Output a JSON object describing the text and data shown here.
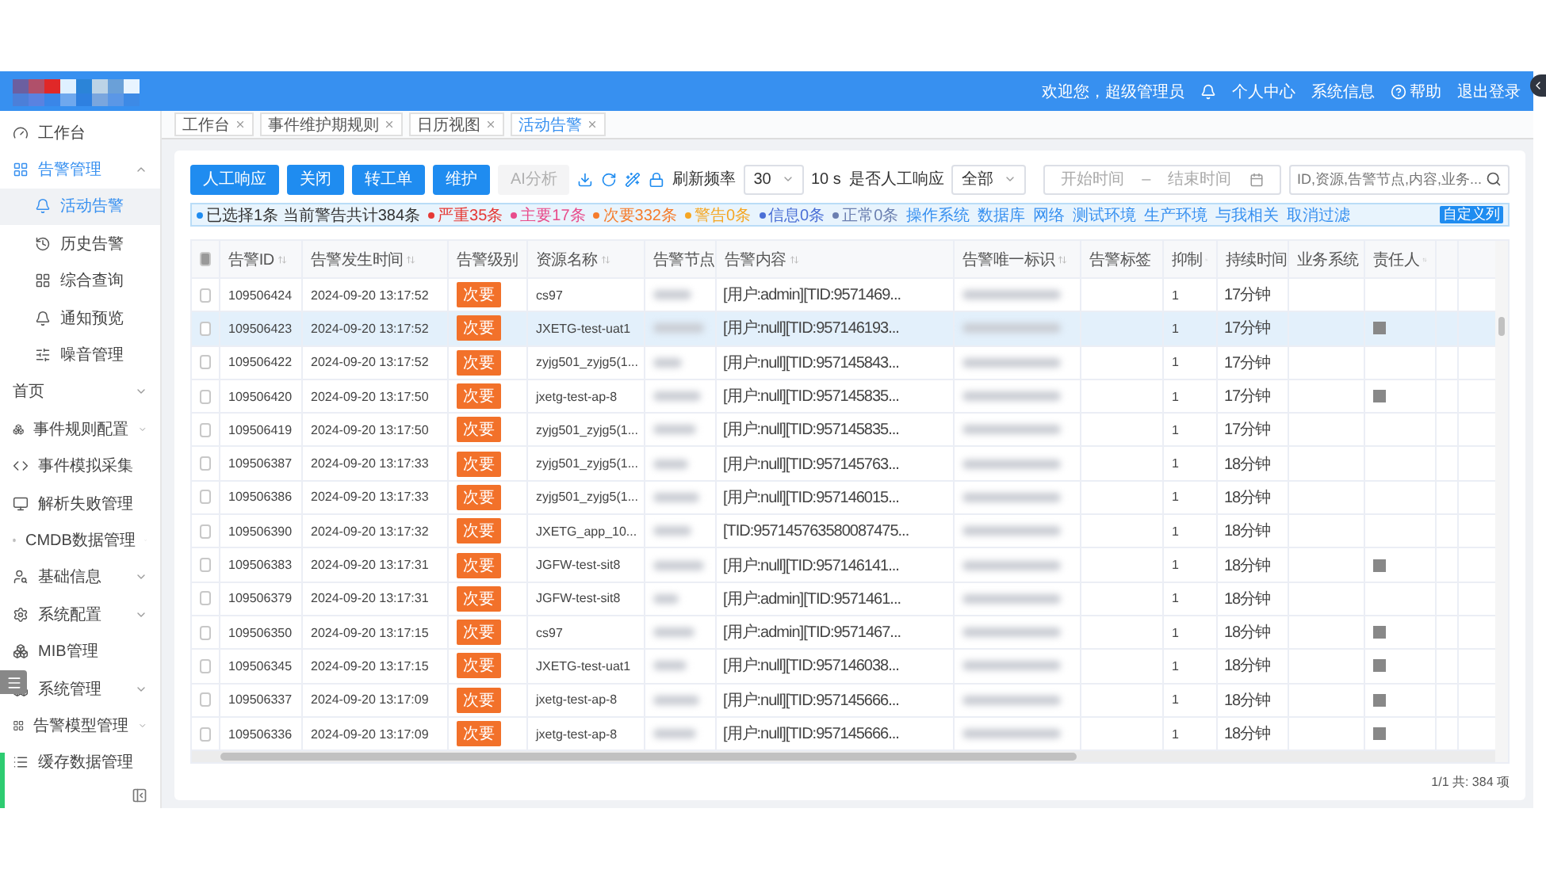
{
  "header": {
    "greeting": "欢迎您，超级管理员",
    "links": [
      {
        "kind": "bell"
      },
      {
        "kind": "text",
        "label": "个人中心"
      },
      {
        "kind": "text",
        "label": "系统信息"
      },
      {
        "kind": "help",
        "label": "帮助"
      },
      {
        "kind": "text",
        "label": "退出登录"
      }
    ]
  },
  "sidebar": {
    "items": [
      {
        "label": "工作台"
      },
      {
        "label": "告警管理",
        "expanded": true,
        "children": [
          {
            "label": "活动告警",
            "selected": true
          },
          {
            "label": "历史告警",
            "selected": false
          },
          {
            "label": "综合查询",
            "selected": false
          },
          {
            "label": "通知预览",
            "selected": false
          },
          {
            "label": "噪音管理",
            "selected": false
          }
        ]
      },
      {
        "label": "首页",
        "expanded": false
      },
      {
        "label": "事件规则配置",
        "expanded": false
      },
      {
        "label": "事件模拟采集"
      },
      {
        "label": "解析失败管理"
      },
      {
        "label": "CMDB数据管理",
        "expanded": false
      },
      {
        "label": "基础信息",
        "expanded": false
      },
      {
        "label": "系统配置",
        "expanded": false
      },
      {
        "label": "MIB管理"
      },
      {
        "label": "系统管理",
        "expanded": false
      },
      {
        "label": "告警模型管理",
        "expanded": false
      },
      {
        "label": "缓存数据管理"
      }
    ]
  },
  "tabs": [
    {
      "label": "工作台",
      "selected": false
    },
    {
      "label": "事件维护期规则",
      "selected": false
    },
    {
      "label": "日历视图",
      "selected": false
    },
    {
      "label": "活动告警",
      "selected": true
    }
  ],
  "toolbar": {
    "buttons": [
      {
        "label": "人工响应",
        "disabled": false
      },
      {
        "label": "关闭",
        "disabled": false
      },
      {
        "label": "转工单",
        "disabled": false
      },
      {
        "label": "维护",
        "disabled": false
      },
      {
        "label": "AI分析",
        "disabled": true
      }
    ],
    "refresh_label": "刷新频率",
    "refresh_value": "30",
    "refresh_reading": "10 s",
    "manual_label": "是否人工响应",
    "manual_value": "全部",
    "start_placeholder": "开始时间",
    "range_separator": "–",
    "end_placeholder": "结束时间",
    "search_placeholder": "ID,资源,告警节点,内容,业务..."
  },
  "filter_bar": {
    "summary": "已选择1条 当前警告共计384条",
    "severities": [
      {
        "label": "严重35条",
        "color": "#e53935"
      },
      {
        "label": "主要17条",
        "color": "#e84c8b"
      },
      {
        "label": "次要332条",
        "color": "#f57c2c"
      },
      {
        "label": "警告0条",
        "color": "#f5a623"
      },
      {
        "label": "信息0条",
        "color": "#4a6fd6"
      },
      {
        "label": "正常0条",
        "color": "#6b7fb0"
      }
    ],
    "tags": [
      "操作系统",
      "数据库",
      "网络",
      "测试环境",
      "生产环境",
      "与我相关"
    ],
    "clear": "取消过滤",
    "custom_columns": "自定义列"
  },
  "table": {
    "select_all_partial": true,
    "columns": [
      "告警ID",
      "告警发生时间",
      "告警级别",
      "资源名称",
      "告警节点",
      "告警内容",
      "告警唯一标识",
      "告警标签",
      "抑制",
      "持续时间",
      "业务系统",
      "责任人"
    ],
    "rows": [
      {
        "id": "109506424",
        "time": "2024-09-20 13:17:52",
        "level": "次要",
        "resource": "cs97",
        "content": "[用户:admin][TID:9571469...",
        "suppress": "1",
        "duration": "17分钟",
        "owner_shown": false,
        "selected": false
      },
      {
        "id": "109506423",
        "time": "2024-09-20 13:17:52",
        "level": "次要",
        "resource": "JXETG-test-uat1",
        "content": "[用户:null][TID:957146193...",
        "suppress": "1",
        "duration": "17分钟",
        "owner_shown": true,
        "selected": true
      },
      {
        "id": "109506422",
        "time": "2024-09-20 13:17:52",
        "level": "次要",
        "resource": "zyjg501_zyjg5(1...",
        "content": "[用户:null][TID:957145843...",
        "suppress": "1",
        "duration": "17分钟",
        "owner_shown": false,
        "selected": false
      },
      {
        "id": "109506420",
        "time": "2024-09-20 13:17:50",
        "level": "次要",
        "resource": "jxetg-test-ap-8",
        "content": "[用户:null][TID:957145835...",
        "suppress": "1",
        "duration": "17分钟",
        "owner_shown": true,
        "selected": false
      },
      {
        "id": "109506419",
        "time": "2024-09-20 13:17:50",
        "level": "次要",
        "resource": "zyjg501_zyjg5(1...",
        "content": "[用户:null][TID:957145835...",
        "suppress": "1",
        "duration": "17分钟",
        "owner_shown": false,
        "selected": false
      },
      {
        "id": "109506387",
        "time": "2024-09-20 13:17:33",
        "level": "次要",
        "resource": "zyjg501_zyjg5(1...",
        "content": "[用户:null][TID:957145763...",
        "suppress": "1",
        "duration": "18分钟",
        "owner_shown": false,
        "selected": false
      },
      {
        "id": "109506386",
        "time": "2024-09-20 13:17:33",
        "level": "次要",
        "resource": "zyjg501_zyjg5(1...",
        "content": "[用户:null][TID:957146015...",
        "suppress": "1",
        "duration": "18分钟",
        "owner_shown": false,
        "selected": false
      },
      {
        "id": "109506390",
        "time": "2024-09-20 13:17:32",
        "level": "次要",
        "resource": "JXETG_app_10...",
        "content": "[TID:957145763580087475...",
        "suppress": "1",
        "duration": "18分钟",
        "owner_shown": false,
        "selected": false
      },
      {
        "id": "109506383",
        "time": "2024-09-20 13:17:31",
        "level": "次要",
        "resource": "JGFW-test-sit8",
        "content": "[用户:null][TID:957146141...",
        "suppress": "1",
        "duration": "18分钟",
        "owner_shown": true,
        "selected": false
      },
      {
        "id": "109506379",
        "time": "2024-09-20 13:17:31",
        "level": "次要",
        "resource": "JGFW-test-sit8",
        "content": "[用户:admin][TID:9571461...",
        "suppress": "1",
        "duration": "18分钟",
        "owner_shown": false,
        "selected": false
      },
      {
        "id": "109506350",
        "time": "2024-09-20 13:17:15",
        "level": "次要",
        "resource": "cs97",
        "content": "[用户:admin][TID:9571467...",
        "suppress": "1",
        "duration": "18分钟",
        "owner_shown": true,
        "selected": false
      },
      {
        "id": "109506345",
        "time": "2024-09-20 13:17:15",
        "level": "次要",
        "resource": "JXETG-test-uat1",
        "content": "[用户:null][TID:957146038...",
        "suppress": "1",
        "duration": "18分钟",
        "owner_shown": true,
        "selected": false
      },
      {
        "id": "109506337",
        "time": "2024-09-20 13:17:09",
        "level": "次要",
        "resource": "jxetg-test-ap-8",
        "content": "[用户:null][TID:957145666...",
        "suppress": "1",
        "duration": "18分钟",
        "owner_shown": true,
        "selected": false
      },
      {
        "id": "109506336",
        "time": "2024-09-20 13:17:09",
        "level": "次要",
        "resource": "jxetg-test-ap-8",
        "content": "[用户:null][TID:957145666...",
        "suppress": "1",
        "duration": "18分钟",
        "owner_shown": true,
        "selected": false
      }
    ]
  },
  "pagination": "1/1 共: 384 项"
}
